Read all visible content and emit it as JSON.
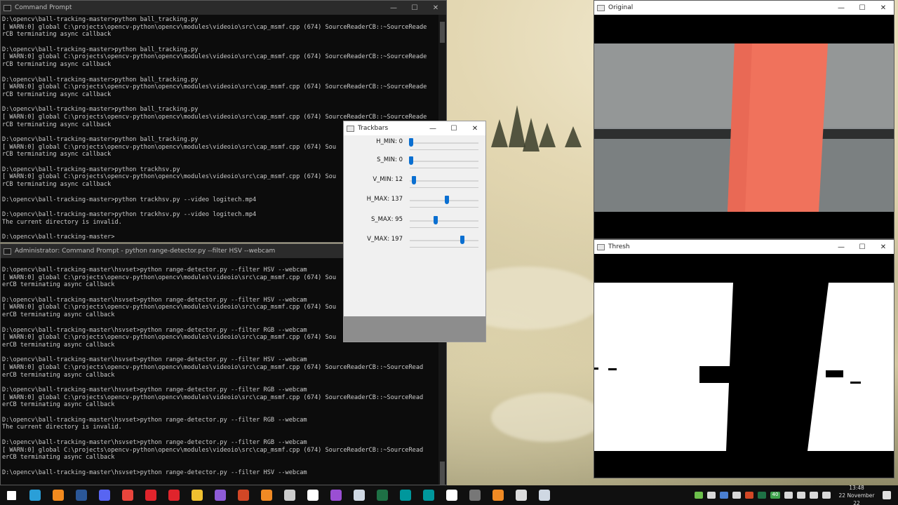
{
  "cmd1": {
    "title": "Command Prompt",
    "lines": [
      "D:\\opencv\\ball-tracking-master>python ball_tracking.py",
      "[ WARN:0] global C:\\projects\\opencv-python\\opencv\\modules\\videoio\\src\\cap_msmf.cpp (674) SourceReaderCB::~SourceReade",
      "rCB terminating async callback",
      "",
      "D:\\opencv\\ball-tracking-master>python ball_tracking.py",
      "[ WARN:0] global C:\\projects\\opencv-python\\opencv\\modules\\videoio\\src\\cap_msmf.cpp (674) SourceReaderCB::~SourceReade",
      "rCB terminating async callback",
      "",
      "D:\\opencv\\ball-tracking-master>python ball_tracking.py",
      "[ WARN:0] global C:\\projects\\opencv-python\\opencv\\modules\\videoio\\src\\cap_msmf.cpp (674) SourceReaderCB::~SourceReade",
      "rCB terminating async callback",
      "",
      "D:\\opencv\\ball-tracking-master>python ball_tracking.py",
      "[ WARN:0] global C:\\projects\\opencv-python\\opencv\\modules\\videoio\\src\\cap_msmf.cpp (674) SourceReaderCB::~SourceReade",
      "rCB terminating async callback",
      "",
      "D:\\opencv\\ball-tracking-master>python ball_tracking.py",
      "[ WARN:0] global C:\\projects\\opencv-python\\opencv\\modules\\videoio\\src\\cap_msmf.cpp (674) Sou",
      "rCB terminating async callback",
      "",
      "D:\\opencv\\ball-tracking-master>python trackhsv.py",
      "[ WARN:0] global C:\\projects\\opencv-python\\opencv\\modules\\videoio\\src\\cap_msmf.cpp (674) Sou",
      "rCB terminating async callback",
      "",
      "D:\\opencv\\ball-tracking-master>python trackhsv.py --video logitech.mp4",
      "",
      "D:\\opencv\\ball-tracking-master>python trackhsv.py --video logitech.mp4",
      "The current directory is invalid.",
      "",
      "D:\\opencv\\ball-tracking-master>"
    ]
  },
  "cmd2": {
    "title": "Administrator: Command Prompt - python  range-detector.py --filter HSV --webcam",
    "lines": [
      "D:\\opencv\\ball-tracking-master\\hsvset>python range-detector.py --filter HSV --webcam",
      "[ WARN:0] global C:\\projects\\opencv-python\\opencv\\modules\\videoio\\src\\cap_msmf.cpp (674) Sou",
      "erCB terminating async callback",
      "",
      "D:\\opencv\\ball-tracking-master\\hsvset>python range-detector.py --filter HSV --webcam",
      "[ WARN:0] global C:\\projects\\opencv-python\\opencv\\modules\\videoio\\src\\cap_msmf.cpp (674) Sou",
      "erCB terminating async callback",
      "",
      "D:\\opencv\\ball-tracking-master\\hsvset>python range-detector.py --filter RGB --webcam",
      "[ WARN:0] global C:\\projects\\opencv-python\\opencv\\modules\\videoio\\src\\cap_msmf.cpp (674) Sou",
      "erCB terminating async callback",
      "",
      "D:\\opencv\\ball-tracking-master\\hsvset>python range-detector.py --filter HSV --webcam",
      "[ WARN:0] global C:\\projects\\opencv-python\\opencv\\modules\\videoio\\src\\cap_msmf.cpp (674) SourceReaderCB::~SourceRead",
      "erCB terminating async callback",
      "",
      "D:\\opencv\\ball-tracking-master\\hsvset>python range-detector.py --filter RGB --webcam",
      "[ WARN:0] global C:\\projects\\opencv-python\\opencv\\modules\\videoio\\src\\cap_msmf.cpp (674) SourceReaderCB::~SourceRead",
      "erCB terminating async callback",
      "",
      "D:\\opencv\\ball-tracking-master\\hsvset>python range-detector.py --filter RGB --webcam",
      "The current directory is invalid.",
      "",
      "D:\\opencv\\ball-tracking-master\\hsvset>python range-detector.py --filter RGB --webcam",
      "[ WARN:0] global C:\\projects\\opencv-python\\opencv\\modules\\videoio\\src\\cap_msmf.cpp (674) SourceReaderCB::~SourceRead",
      "erCB terminating async callback",
      "",
      "D:\\opencv\\ball-tracking-master\\hsvset>python range-detector.py --filter HSV --webcam"
    ]
  },
  "trackbars": {
    "title": "Trackbars",
    "sliders": [
      {
        "label": "H_MIN: 0",
        "value": 0,
        "max": 255
      },
      {
        "label": "S_MIN: 0",
        "value": 0,
        "max": 255
      },
      {
        "label": "V_MIN: 12",
        "value": 12,
        "max": 255
      },
      {
        "label": "H_MAX: 137",
        "value": 137,
        "max": 255
      },
      {
        "label": "S_MAX: 95",
        "value": 95,
        "max": 255
      },
      {
        "label": "V_MAX: 197",
        "value": 197,
        "max": 255
      }
    ]
  },
  "original": {
    "title": "Original"
  },
  "thresh": {
    "title": "Thresh"
  },
  "caption_buttons": {
    "min": "—",
    "max": "☐",
    "close": "✕"
  },
  "taskbar": {
    "icons": [
      {
        "name": "start",
        "color": "#ffffff"
      },
      {
        "name": "edge",
        "color": "#2a9fd8"
      },
      {
        "name": "vlc",
        "color": "#f28a1e"
      },
      {
        "name": "word",
        "color": "#2b5797"
      },
      {
        "name": "discord",
        "color": "#5865f2"
      },
      {
        "name": "chrome",
        "color": "#e8453c"
      },
      {
        "name": "opera",
        "color": "#e0242c"
      },
      {
        "name": "opera-gx",
        "color": "#e0242c"
      },
      {
        "name": "file-explorer",
        "color": "#f0c030"
      },
      {
        "name": "visual-studio",
        "color": "#8e5bd6"
      },
      {
        "name": "powerpoint",
        "color": "#d24726"
      },
      {
        "name": "sublime",
        "color": "#f08a24"
      },
      {
        "name": "mp3tag",
        "color": "#cccccc"
      },
      {
        "name": "github",
        "color": "#ffffff"
      },
      {
        "name": "app-g",
        "color": "#9a4fd3"
      },
      {
        "name": "camera",
        "color": "#cfd8e3"
      },
      {
        "name": "excel",
        "color": "#1e7145"
      },
      {
        "name": "arduino",
        "color": "#00979c"
      },
      {
        "name": "arduino-2",
        "color": "#00979c"
      },
      {
        "name": "settings",
        "color": "#ffffff"
      },
      {
        "name": "terminal",
        "color": "#777777"
      },
      {
        "name": "sublime-2",
        "color": "#f08a24"
      },
      {
        "name": "obs",
        "color": "#dddddd"
      },
      {
        "name": "app-lock",
        "color": "#cfd8e3"
      }
    ],
    "tray_badge": "40",
    "time": "13:48",
    "date": "22 November 22"
  }
}
